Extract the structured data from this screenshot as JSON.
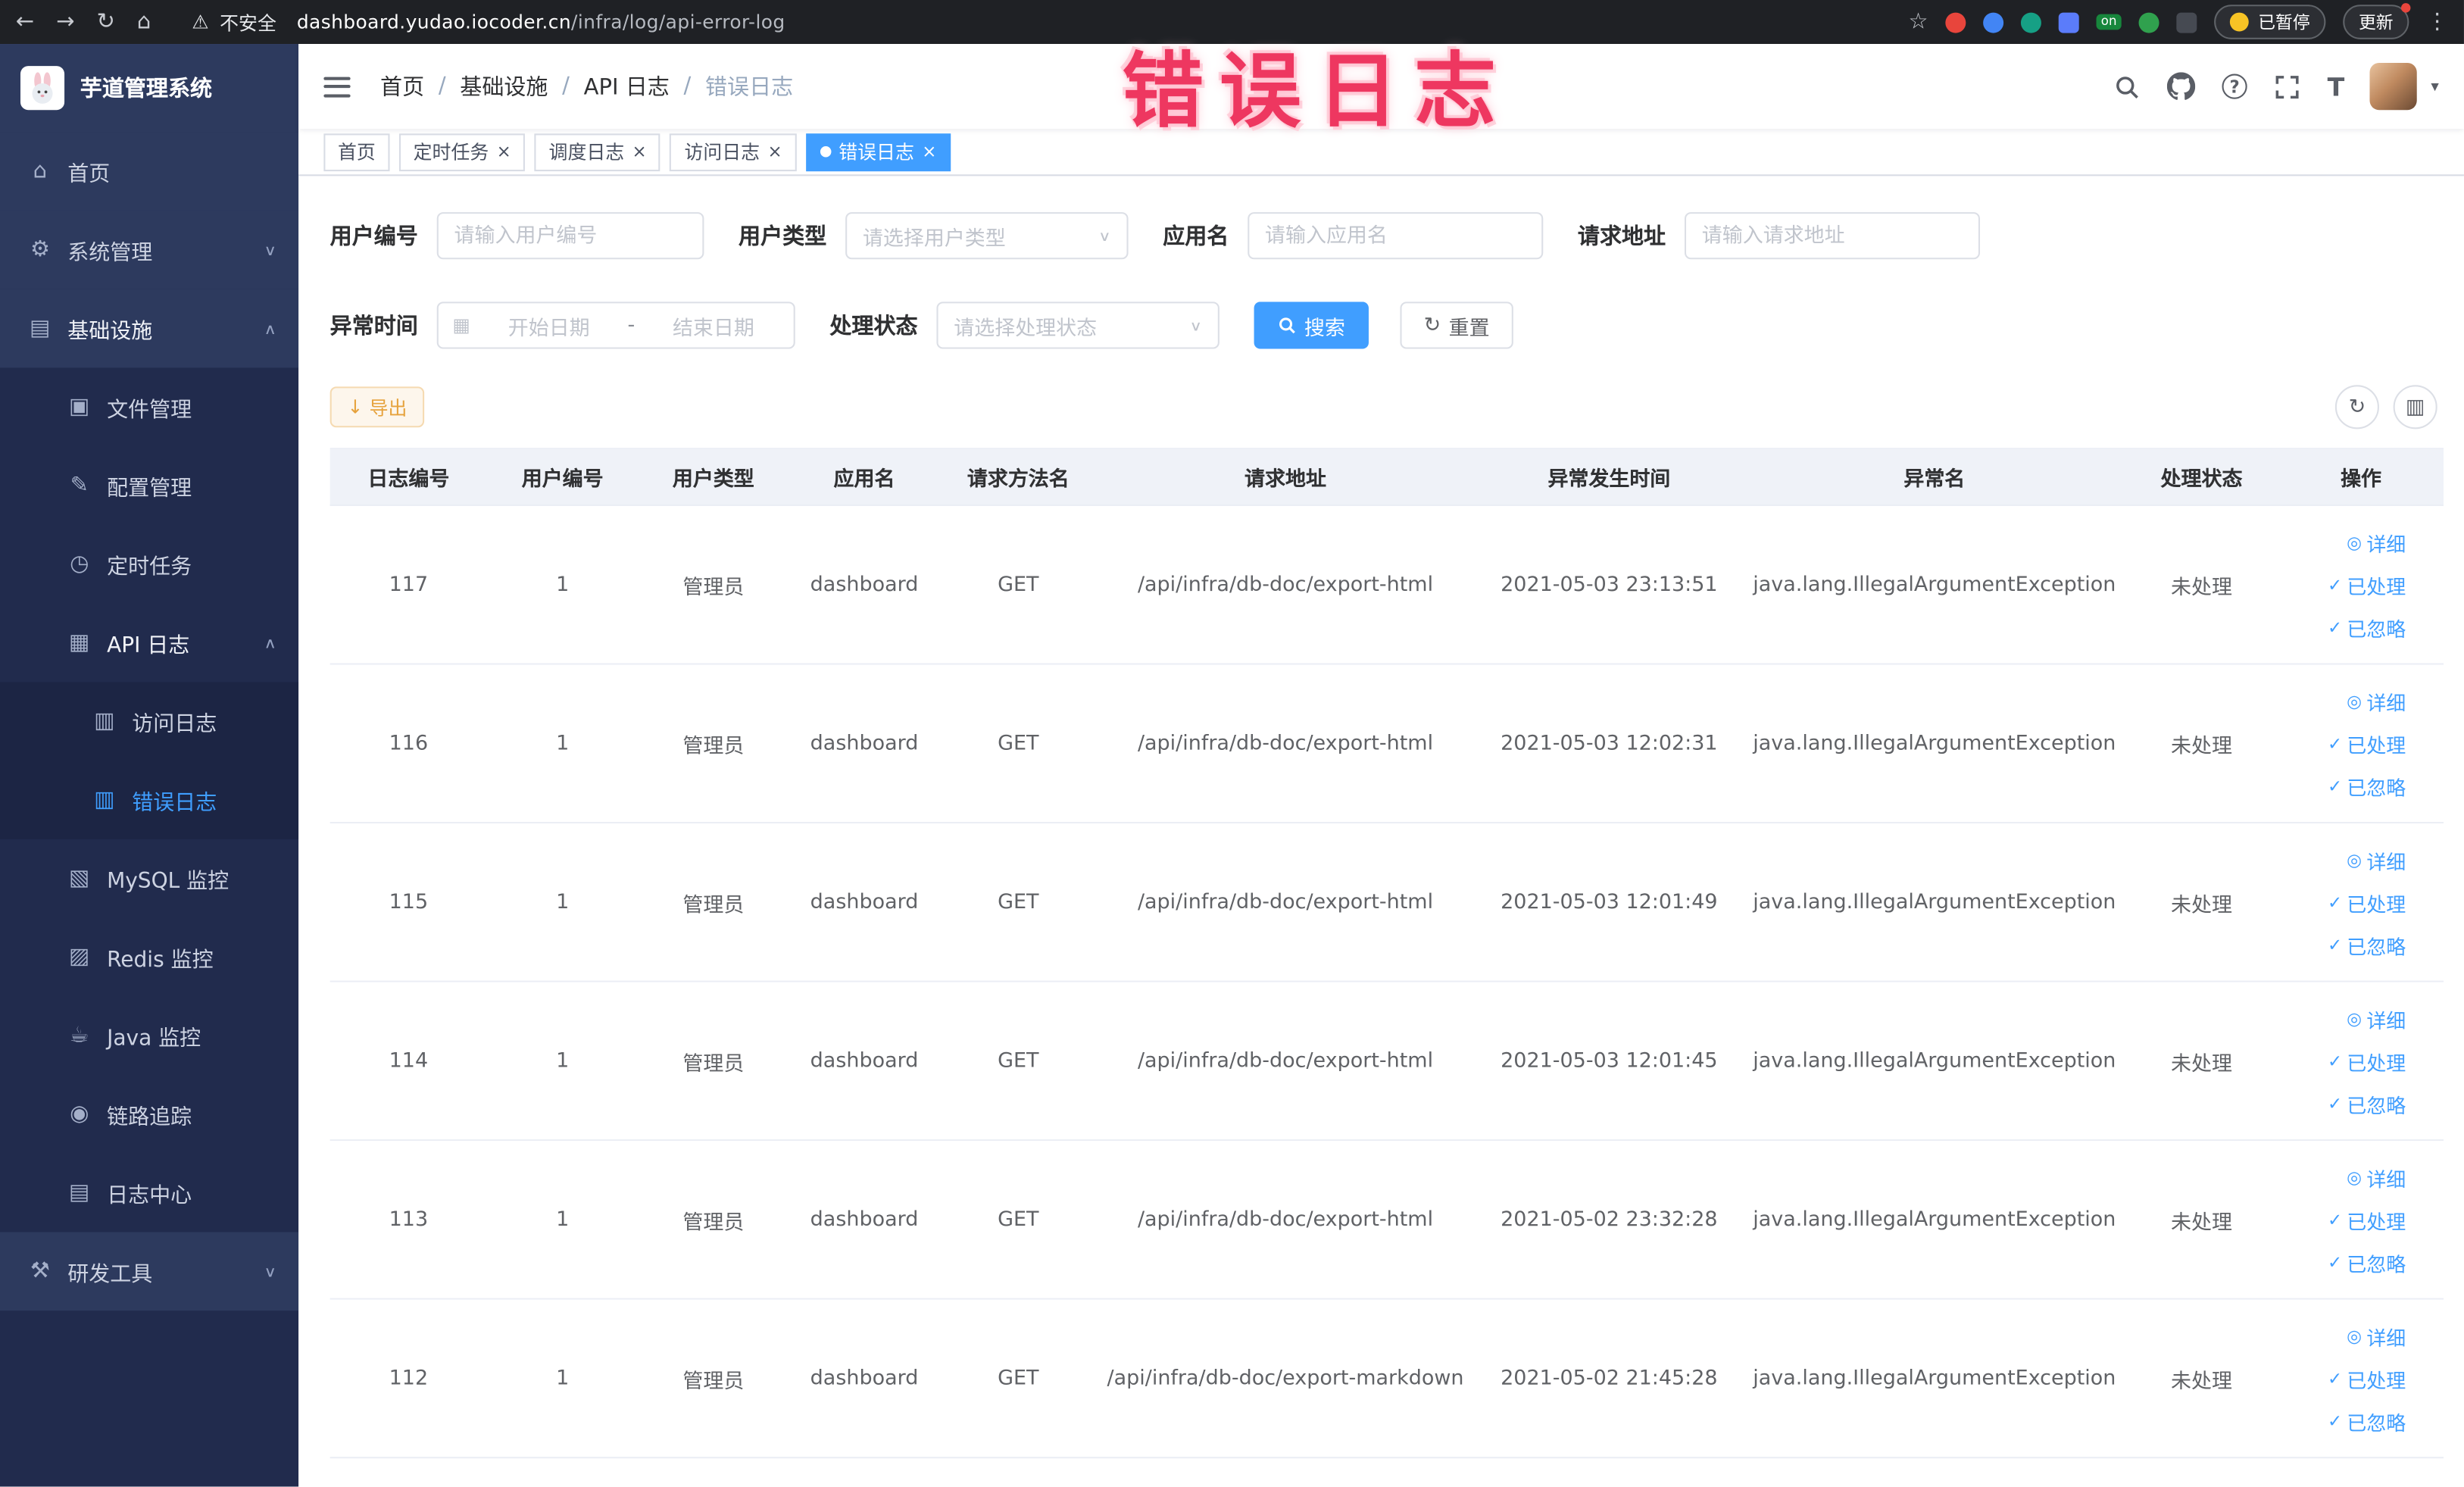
{
  "browser": {
    "security_label": "不安全",
    "url_domain": "dashboard.yudao.iocoder.cn",
    "url_path": "/infra/log/api-error-log",
    "on_badge": "on",
    "paused_badge": "已暂停",
    "update_label": "更新"
  },
  "annotation": {
    "text": "错误日志"
  },
  "app": {
    "title": "芋道管理系统"
  },
  "sidebar": {
    "items": [
      {
        "label": "首页"
      },
      {
        "label": "系统管理"
      },
      {
        "label": "基础设施"
      },
      {
        "label": "文件管理"
      },
      {
        "label": "配置管理"
      },
      {
        "label": "定时任务"
      },
      {
        "label": "API 日志"
      },
      {
        "label": "访问日志"
      },
      {
        "label": "错误日志"
      },
      {
        "label": "MySQL 监控"
      },
      {
        "label": "Redis 监控"
      },
      {
        "label": "Java 监控"
      },
      {
        "label": "链路追踪"
      },
      {
        "label": "日志中心"
      },
      {
        "label": "研发工具"
      }
    ]
  },
  "breadcrumb": {
    "separator": "/",
    "items": [
      "首页",
      "基础设施",
      "API 日志",
      "错误日志"
    ]
  },
  "tabs": [
    {
      "label": "首页"
    },
    {
      "label": "定时任务"
    },
    {
      "label": "调度日志"
    },
    {
      "label": "访问日志"
    },
    {
      "label": "错误日志"
    }
  ],
  "filters": {
    "user_id": {
      "label": "用户编号",
      "placeholder": "请输入用户编号"
    },
    "user_type": {
      "label": "用户类型",
      "placeholder": "请选择用户类型"
    },
    "app_name": {
      "label": "应用名",
      "placeholder": "请输入应用名"
    },
    "request_url": {
      "label": "请求地址",
      "placeholder": "请输入请求地址"
    },
    "exception_time": {
      "label": "异常时间",
      "start_placeholder": "开始日期",
      "separator": "-",
      "end_placeholder": "结束日期"
    },
    "process_status": {
      "label": "处理状态",
      "placeholder": "请选择处理状态"
    },
    "search_label": "搜索",
    "reset_label": "重置"
  },
  "toolbar": {
    "export_label": "导出"
  },
  "table": {
    "columns": [
      "日志编号",
      "用户编号",
      "用户类型",
      "应用名",
      "请求方法名",
      "请求地址",
      "异常发生时间",
      "异常名",
      "处理状态",
      "操作"
    ],
    "actions": {
      "detail": "详细",
      "processed": "已处理",
      "ignored": "已忽略"
    },
    "rows": [
      {
        "id": "117",
        "user_id": "1",
        "user_type": "管理员",
        "app": "dashboard",
        "method": "GET",
        "url": "/api/infra/db-doc/export-html",
        "time": "2021-05-03 23:13:51",
        "exception": "java.lang.IllegalArgumentException",
        "status": "未处理"
      },
      {
        "id": "116",
        "user_id": "1",
        "user_type": "管理员",
        "app": "dashboard",
        "method": "GET",
        "url": "/api/infra/db-doc/export-html",
        "time": "2021-05-03 12:02:31",
        "exception": "java.lang.IllegalArgumentException",
        "status": "未处理"
      },
      {
        "id": "115",
        "user_id": "1",
        "user_type": "管理员",
        "app": "dashboard",
        "method": "GET",
        "url": "/api/infra/db-doc/export-html",
        "time": "2021-05-03 12:01:49",
        "exception": "java.lang.IllegalArgumentException",
        "status": "未处理"
      },
      {
        "id": "114",
        "user_id": "1",
        "user_type": "管理员",
        "app": "dashboard",
        "method": "GET",
        "url": "/api/infra/db-doc/export-html",
        "time": "2021-05-03 12:01:45",
        "exception": "java.lang.IllegalArgumentException",
        "status": "未处理"
      },
      {
        "id": "113",
        "user_id": "1",
        "user_type": "管理员",
        "app": "dashboard",
        "method": "GET",
        "url": "/api/infra/db-doc/export-html",
        "time": "2021-05-02 23:32:28",
        "exception": "java.lang.IllegalArgumentException",
        "status": "未处理"
      },
      {
        "id": "112",
        "user_id": "1",
        "user_type": "管理员",
        "app": "dashboard",
        "method": "GET",
        "url": "/api/infra/db-doc/export-markdown",
        "time": "2021-05-02 21:45:28",
        "exception": "java.lang.IllegalArgumentException",
        "status": "未处理"
      }
    ]
  },
  "icons": {
    "back": "←",
    "forward": "→",
    "reload": "↻",
    "home": "⌂",
    "warning": "⚠",
    "star": "☆",
    "kebab": "⋮",
    "caret_down": "▾",
    "chevron_down": "∨",
    "chevron_up": "∧",
    "close": "×",
    "calendar": "▦",
    "download": "↓",
    "refresh": "↻",
    "columns": "▥",
    "check": "✓",
    "eye": "◎",
    "question": "?",
    "font_size": "T",
    "menu_home": "⌂",
    "menu_system": "⚙",
    "menu_infra": "▤",
    "menu_file": "▣",
    "menu_config": "✎",
    "menu_job": "◷",
    "menu_api_log": "▦",
    "menu_access_log": "▥",
    "menu_error_log": "▥",
    "menu_mysql": "▧",
    "menu_redis": "▨",
    "menu_java": "☕",
    "menu_trace": "◉",
    "menu_log_center": "▤",
    "menu_dev_tools": "⚒"
  },
  "colors": {
    "accent": "#409eff",
    "warning": "#e6a23c",
    "annotation_pink": "#ee3760",
    "sidebar_bg": "#212b4d",
    "sidebar_item_bg": "#2d3a5e",
    "table_header_bg": "#eff2f8"
  }
}
